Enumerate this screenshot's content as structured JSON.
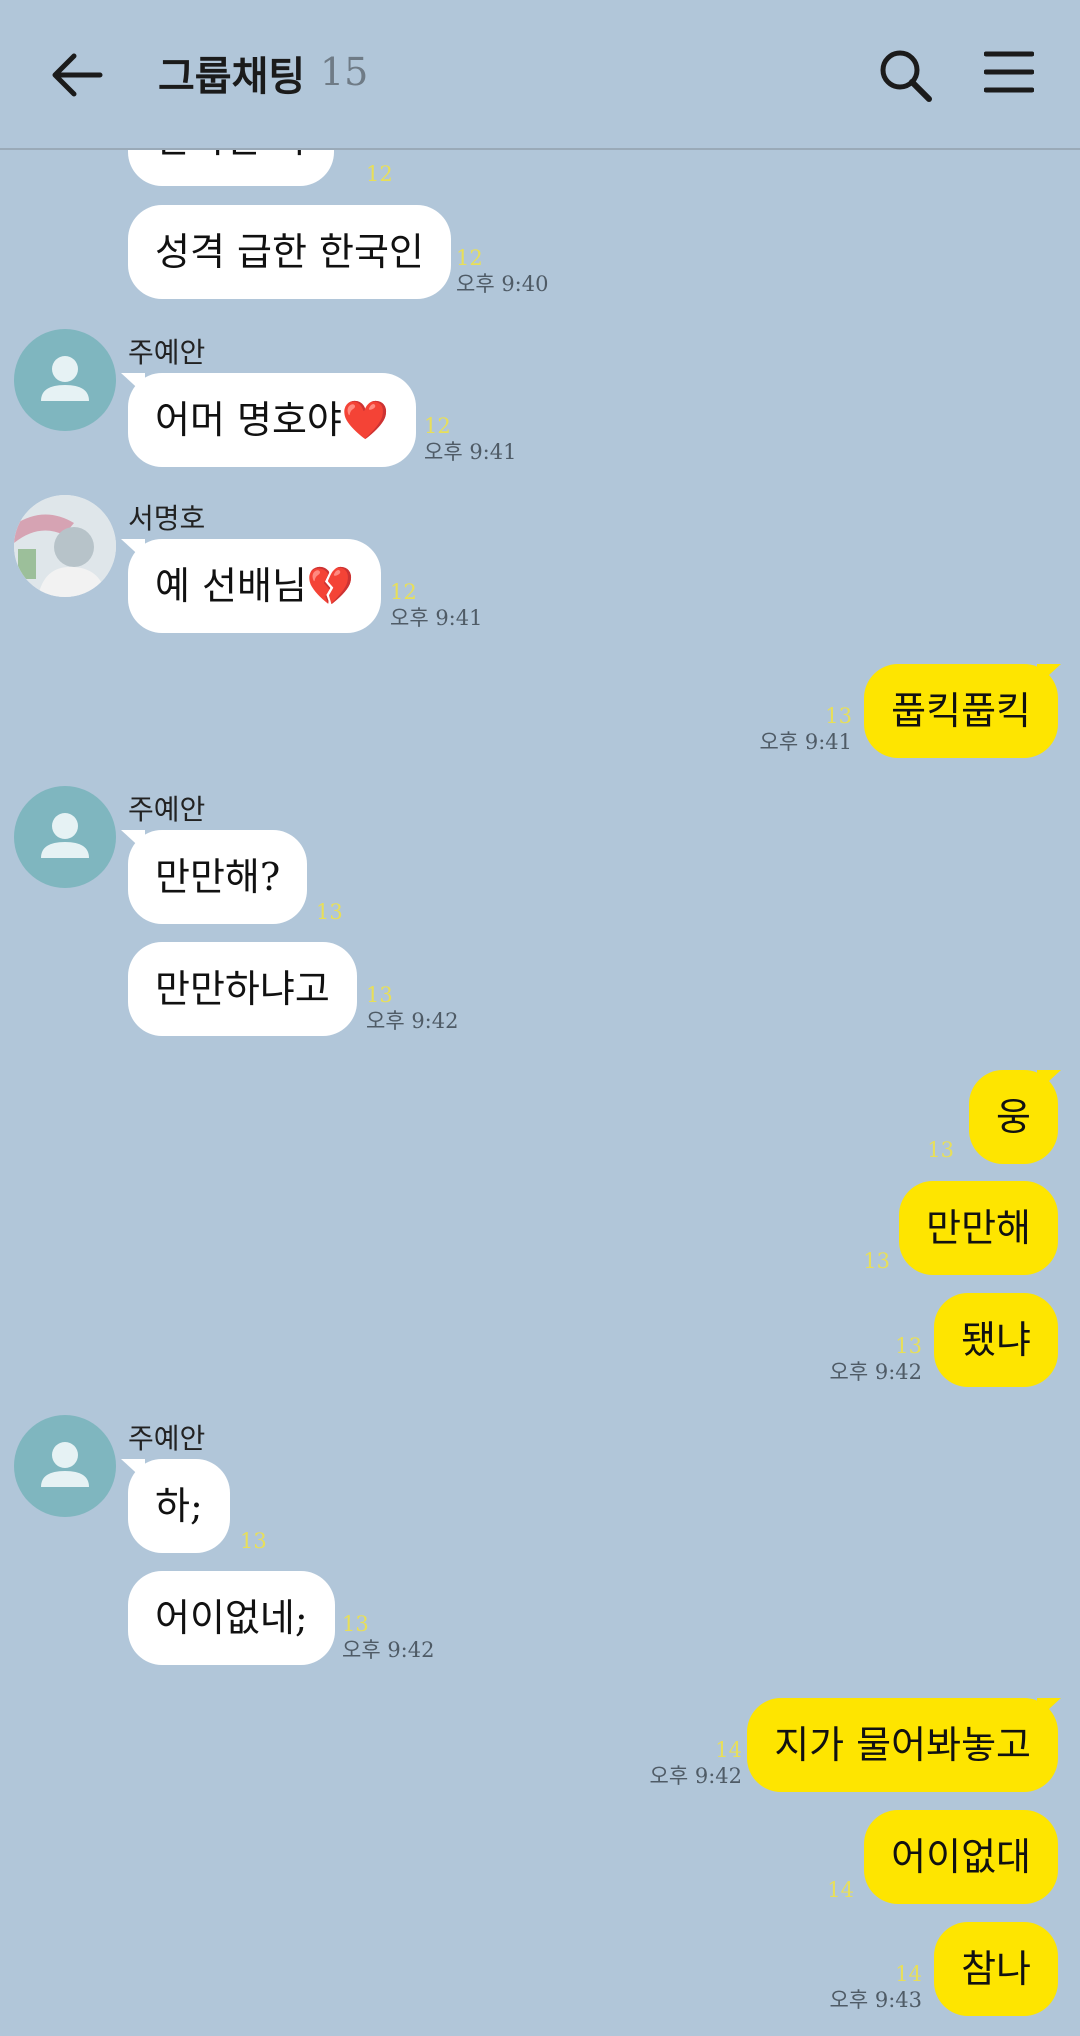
{
  "header": {
    "back_icon": "arrow-left-icon",
    "title": "그룹채팅",
    "member_count": "15",
    "search_icon": "search-icon",
    "menu_icon": "menu-icon"
  },
  "colors": {
    "background": "#b1c6d9",
    "incoming_bubble": "#ffffff",
    "outgoing_bubble": "#fee500",
    "unread_count": "#e8df59",
    "timestamp": "#4f5b66",
    "default_avatar": "#7fb6bf"
  },
  "messages": [
    {
      "id": "m0",
      "direction": "in",
      "text": "한국인 특",
      "unread": "12",
      "time": ""
    },
    {
      "id": "m1",
      "direction": "in",
      "text": "성격 급한 한국인",
      "unread": "12",
      "time": "오후 9:40"
    },
    {
      "id": "m2",
      "direction": "in",
      "sender": "주예안",
      "text": "어머 명호야❤️",
      "unread": "12",
      "time": "오후 9:41"
    },
    {
      "id": "m3",
      "direction": "in",
      "sender": "서명호",
      "text": "예 선배님💔",
      "unread": "12",
      "time": "오후 9:41"
    },
    {
      "id": "m4",
      "direction": "out",
      "text": "풉킥풉킥",
      "unread": "13",
      "time": "오후 9:41"
    },
    {
      "id": "m5",
      "direction": "in",
      "sender": "주예안",
      "text": "만만해?",
      "unread": "13",
      "time": ""
    },
    {
      "id": "m6",
      "direction": "in",
      "text": "만만하냐고",
      "unread": "13",
      "time": "오후 9:42"
    },
    {
      "id": "m7",
      "direction": "out",
      "text": "웅",
      "unread": "13",
      "time": ""
    },
    {
      "id": "m8",
      "direction": "out",
      "text": "만만해",
      "unread": "13",
      "time": ""
    },
    {
      "id": "m9",
      "direction": "out",
      "text": "됐냐",
      "unread": "13",
      "time": "오후 9:42"
    },
    {
      "id": "m10",
      "direction": "in",
      "sender": "주예안",
      "text": "하;",
      "unread": "13",
      "time": ""
    },
    {
      "id": "m11",
      "direction": "in",
      "text": "어이없네;",
      "unread": "13",
      "time": "오후 9:42"
    },
    {
      "id": "m12",
      "direction": "out",
      "text": "지가 물어봐놓고",
      "unread": "14",
      "time": "오후 9:42"
    },
    {
      "id": "m13",
      "direction": "out",
      "text": "어이없대",
      "unread": "14",
      "time": ""
    },
    {
      "id": "m14",
      "direction": "out",
      "text": "참나",
      "unread": "14",
      "time": "오후 9:43"
    }
  ]
}
